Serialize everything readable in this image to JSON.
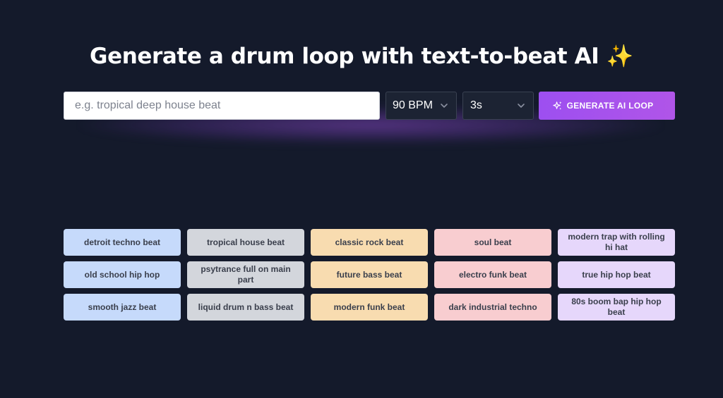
{
  "header": {
    "title": "Generate a drum loop with text-to-beat AI",
    "title_emoji": "✨"
  },
  "form": {
    "prompt_placeholder": "e.g. tropical deep house beat",
    "prompt_value": "",
    "bpm_selected": "90 BPM",
    "duration_selected": "3s",
    "generate_label": "GENERATE AI LOOP",
    "generate_icon": "sparkle-icon",
    "accent_color": "#a352ee"
  },
  "presets": {
    "colors": {
      "blue": "#c6dafb",
      "gray": "#d3d6dc",
      "orange": "#f8dcb0",
      "pink": "#f8cdd0",
      "purple": "#e6d7fb"
    },
    "items": [
      {
        "label": "detroit techno beat",
        "color": "blue"
      },
      {
        "label": "tropical house beat",
        "color": "gray"
      },
      {
        "label": "classic rock beat",
        "color": "orange"
      },
      {
        "label": "soul beat",
        "color": "pink"
      },
      {
        "label": "modern trap with rolling hi hat",
        "color": "purple"
      },
      {
        "label": "old school hip hop",
        "color": "blue"
      },
      {
        "label": "psytrance full on main part",
        "color": "gray"
      },
      {
        "label": "future bass beat",
        "color": "orange"
      },
      {
        "label": "electro funk beat",
        "color": "pink"
      },
      {
        "label": "true hip hop beat",
        "color": "purple"
      },
      {
        "label": "smooth jazz beat",
        "color": "blue"
      },
      {
        "label": "liquid drum n bass beat",
        "color": "gray"
      },
      {
        "label": "modern funk beat",
        "color": "orange"
      },
      {
        "label": "dark industrial techno",
        "color": "pink"
      },
      {
        "label": "80s boom bap hip hop beat",
        "color": "purple"
      }
    ]
  }
}
